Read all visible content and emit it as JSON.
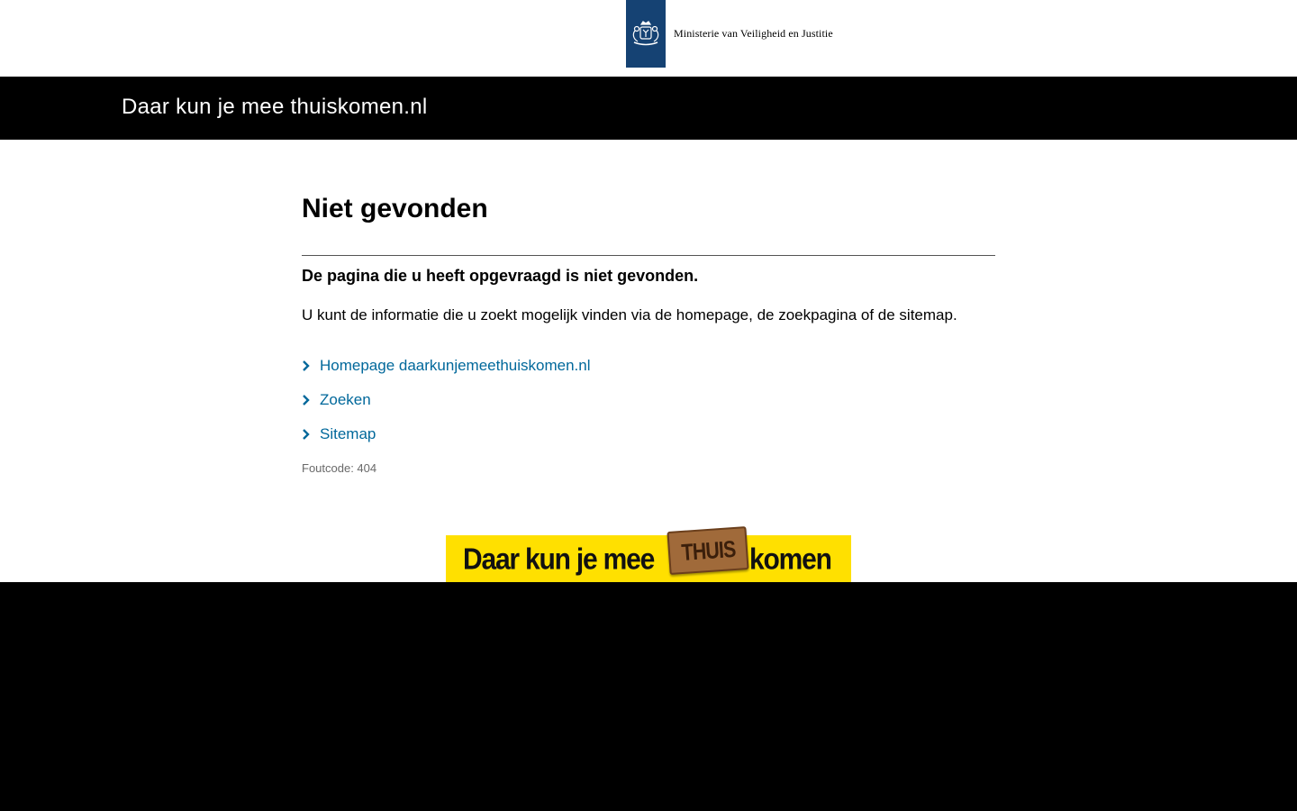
{
  "header": {
    "ministry_name": "Ministerie van Veiligheid en Justitie",
    "site_title": "Daar kun je mee thuiskomen.nl"
  },
  "main": {
    "heading": "Niet gevonden",
    "lead": "De pagina die u heeft opgevraagd is niet gevonden.",
    "info": "U kunt de informatie die u zoekt mogelijk vinden via de homepage, de zoekpagina of de sitemap.",
    "links": [
      {
        "label": "Homepage daarkunjemeethuiskomen.nl"
      },
      {
        "label": "Zoeken"
      },
      {
        "label": "Sitemap"
      }
    ],
    "error_code": "Foutcode: 404"
  },
  "banner": {
    "text_before": "Daar kun je mee",
    "mat_word": "THUIS",
    "text_after": "komen"
  },
  "colors": {
    "logo_blue": "#154273",
    "link": "#01689b",
    "banner_yellow": "#ffe000"
  }
}
